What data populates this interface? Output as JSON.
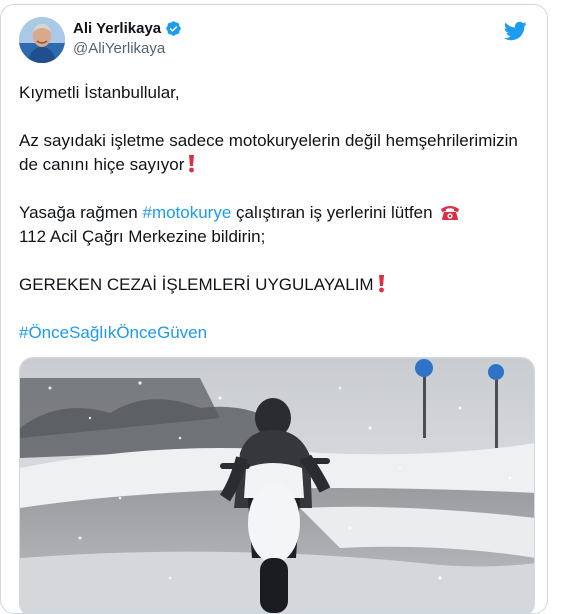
{
  "tweet": {
    "author_name": "Ali Yerlikaya",
    "author_handle": "@AliYerlikaya",
    "verified": true,
    "paragraphs": {
      "p1": "Kıymetli İstanbullular,",
      "p2_line": "Az sayıdaki işletme sadece motokuryelerin değil hemşehrilerimizin de canını hiçe sayıyor",
      "p3_before": "Yasağa rağmen ",
      "p3_hashtag": "#motokurye",
      "p3_after": " çalıştıran iş yerlerini lütfen",
      "p3_line2": "112 Acil Çağrı Merkezine bildirin;",
      "p4": "GEREKEN CEZAİ İŞLEMLERİ UYGULAYALIM",
      "hashtag_line": "#ÖnceSağlıkÖnceGüven"
    },
    "icons": {
      "verified": "verified-badge-icon",
      "brand": "twitter-bird-icon",
      "exclamation": "red-exclamation-emoji",
      "phone": "telephone-emoji"
    },
    "colors": {
      "link": "#1d9bf0",
      "text": "#0f1419",
      "secondary": "#536471",
      "border": "#cfd9de",
      "emoji_red": "#dd2e44"
    }
  }
}
